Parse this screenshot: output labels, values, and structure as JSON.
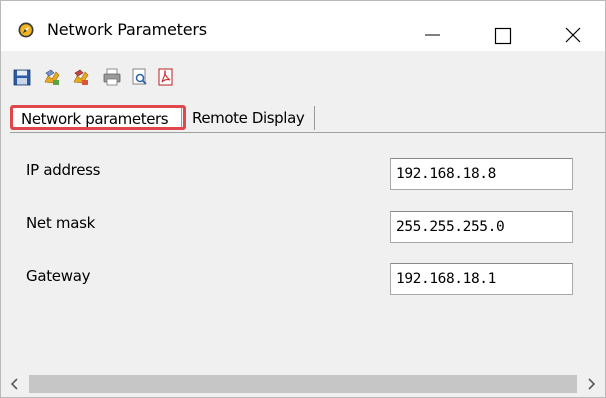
{
  "window": {
    "title": "Network Parameters",
    "icon": "compass-icon"
  },
  "toolbar": {
    "tools": [
      "save-icon",
      "edit-settings-icon",
      "copy-settings-icon",
      "print-icon",
      "print-preview-icon",
      "pdf-export-icon"
    ]
  },
  "tabs": [
    {
      "label": "Network parameters",
      "active": true,
      "highlighted": true
    },
    {
      "label": "Remote Display",
      "active": false
    }
  ],
  "fields": [
    {
      "label": "IP address",
      "value": "192.168.18.8"
    },
    {
      "label": "Net mask",
      "value": "255.255.255.0"
    },
    {
      "label": "Gateway",
      "value": "192.168.18.1"
    }
  ],
  "colors": {
    "highlight": "#e0474c",
    "window_bg": "#f0f0f0"
  }
}
